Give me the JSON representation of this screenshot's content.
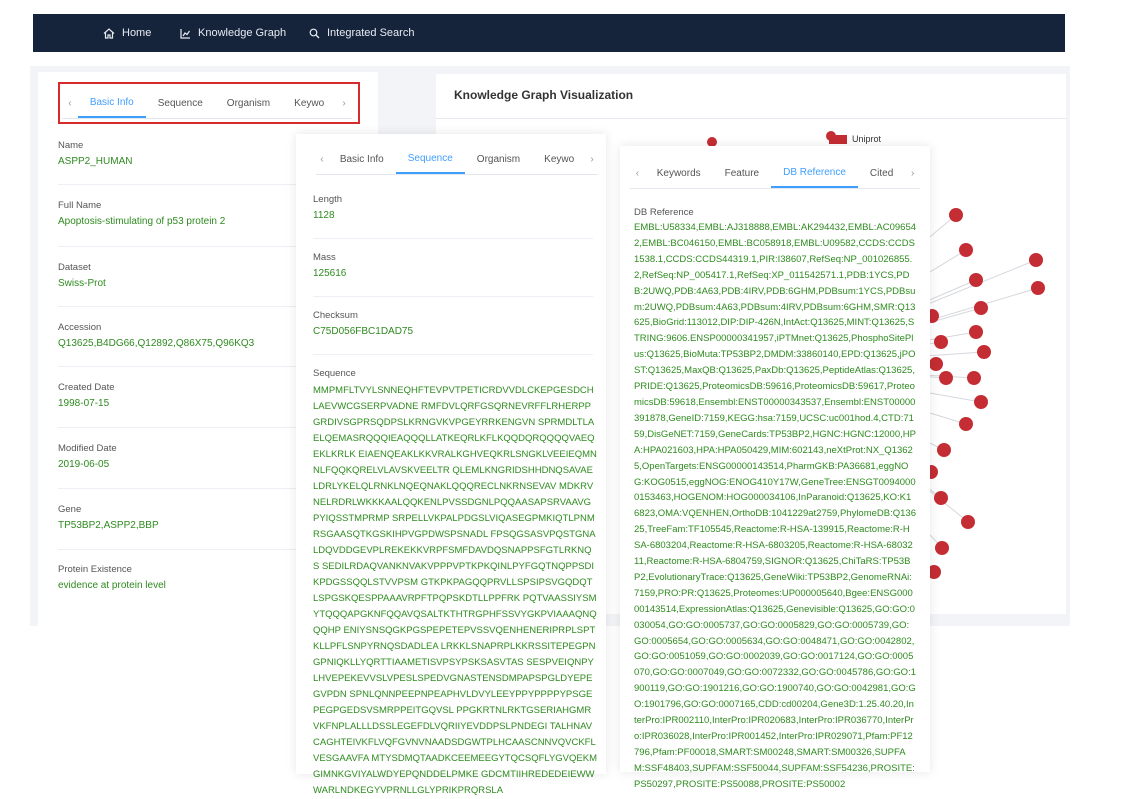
{
  "nav": {
    "items": [
      {
        "label": "Home",
        "icon": "home-icon"
      },
      {
        "label": "Knowledge Graph",
        "icon": "chart-icon"
      },
      {
        "label": "Integrated Search",
        "icon": "search-icon"
      }
    ]
  },
  "panel1": {
    "tabs": [
      "Basic Info",
      "Sequence",
      "Organism",
      "Keywo"
    ],
    "active_tab": "Basic Info",
    "fields": [
      {
        "label": "Name",
        "value": "ASPP2_HUMAN"
      },
      {
        "label": "Full Name",
        "value": "Apoptosis-stimulating of p53 protein 2"
      },
      {
        "label": "Dataset",
        "value": "Swiss-Prot"
      },
      {
        "label": "Accession",
        "value": "Q13625,B4DG66,Q12892,Q86X75,Q96KQ3"
      },
      {
        "label": "Created Date",
        "value": "1998-07-15"
      },
      {
        "label": "Modified Date",
        "value": "2019-06-05"
      },
      {
        "label": "Gene",
        "value": "TP53BP2,ASPP2,BBP"
      },
      {
        "label": "Protein Existence",
        "value": "evidence at protein level"
      }
    ]
  },
  "panel2": {
    "tabs": [
      "Basic Info",
      "Sequence",
      "Organism",
      "Keywo"
    ],
    "active_tab": "Sequence",
    "fields": [
      {
        "label": "Length",
        "value": "1128"
      },
      {
        "label": "Mass",
        "value": "125616"
      },
      {
        "label": "Checksum",
        "value": "C75D056FBC1DAD75"
      }
    ],
    "sequence_label": "Sequence",
    "sequence": "MMPMFLTVYLSNNEQHFTEVPVTPETICRDVVDLCKEPGESDCHLAEVWCGSERPVADNE RMFDVLQRFGSQRNEVRFFLRHERPPGRDIVSGPRSQDPSLKRNGVKVPGEYRRKENGVN SPRMDLTLAELQEMASRQQQIEAQQQLLATKEQRLKFLKQQDQRQQQQVAEQEKLKRLK EIAENQEAKLKKVRALKGHVEQKRLSNGKLVEEIEQMNNLFQQKQRELVLAVSKVEELTR QLEMLKNGRIDSHHDNQSAVAELDRLYKELQLRNKLNQEQNAKLQQQRECLNKRNSEVAV MDKRVNELRDRLWKKKAALQQKENLPVSSDGNLPQQAASAPSRVAAVGPYIQSSTMPRMP SRPELLVKPALPDGSLVIQASEGPMKIQTLPNMRSGAASQTKGSKIHPVGPDWSPSNADL FPSQGSASVPQSTGNALDQVDDGEVPLREKEKKVRPFSMFDAVDQSNAPPSFGTLRKNQS SEDILRDAQVANKNVAKVPPPVPTKPKQINLPYFGQTNQPPSDIKPDGSSQQLSTVVPSM GTKPKPAGQQPRVLLSPSIPSVGQDQTLSPGSKQESPPAAAVRPFTPQPSKDTLLPPFRK PQTVAASSIYSMYTQQQAPGKNFQQAVQSALTKTHTRGPHFSSVYGKPVIAAAQNQQQHP ENIYSNSQGKPGSPEPETEPVSSVQENHENERIPRPLSPTKLLPFLSNPYRNQSDADLEA LRKKLSNAPRPLKKRSSITEPEGPNGPNIQKLLYQRTTIAAMETISVPSYPSKSASVTAS SESPVEIQNPYLHVEPEKEVVSLVPESLSPEDVGNASTENSDMPAPSPGLDYEPEGVPDN SPNLQNNPEEPNPEAPHVLDVYLEEYPPYPPPPYPSGEPEGPGEDSVSMRPPEITGQVSL PPGKRTNLRKTGSERIAHGMRVKFNPLALLLDSSLEGEFDLVQRIIYEVDDPSLPNDEGI TALHNAVCAGHTEIVKFLVQFGVNVNAADSDGWTPLHCAASCNNVQVCKFLVESGAAVFA MTYSDMQTAADKCEEMEEGYTQCSQFLYGVQEKMGIMNKGVIYALWDYEPQNDDELPMKE GDCMTIIHREDEDEIEWWWARLNDKEGYVPRNLLGLYPRIKPRQRSLA"
  },
  "panel3": {
    "tabs": [
      "Keywords",
      "Feature",
      "DB Reference",
      "Cited"
    ],
    "active_tab": "DB Reference",
    "label": "DB Reference",
    "text": "EMBL:U58334,EMBL:AJ318888,EMBL:AK294432,EMBL:AC096542,EMBL:BC046150,EMBL:BC058918,EMBL:U09582,CCDS:CCDS1538.1,CCDS:CCDS44319.1,PIR:I38607,RefSeq:NP_001026855.2,RefSeq:NP_005417.1,RefSeq:XP_011542571.1,PDB:1YCS,PDB:2UWQ,PDB:4A63,PDB:4IRV,PDB:6GHM,PDBsum:1YCS,PDBsum:2UWQ,PDBsum:4A63,PDBsum:4IRV,PDBsum:6GHM,SMR:Q13625,BioGrid:113012,DIP:DIP-426N,IntAct:Q13625,MINT:Q13625,STRING:9606.ENSP00000341957,iPTMnet:Q13625,PhosphoSitePlus:Q13625,BioMuta:TP53BP2,DMDM:33860140,EPD:Q13625,jPOST:Q13625,MaxQB:Q13625,PaxDb:Q13625,PeptideAtlas:Q13625,PRIDE:Q13625,ProteomicsDB:59616,ProteomicsDB:59617,ProteomicsDB:59618,Ensembl:ENST00000343537,Ensembl:ENST00000391878,GeneID:7159,KEGG:hsa:7159,UCSC:uc001hod.4,CTD:7159,DisGeNET:7159,GeneCards:TP53BP2,HGNC:HGNC:12000,HPA:HPA021603,HPA:HPA050429,MIM:602143,neXtProt:NX_Q13625,OpenTargets:ENSG00000143514,PharmGKB:PA36681,eggNOG:KOG0515,eggNOG:ENOG410Y17W,GeneTree:ENSGT00940000153463,HOGENOM:HOG000034106,InParanoid:Q13625,KO:K16823,OMA:VQENHEN,OrthoDB:1041229at2759,PhylomeDB:Q13625,TreeFam:TF105545,Reactome:R-HSA-139915,Reactome:R-HSA-6803204,Reactome:R-HSA-6803205,Reactome:R-HSA-6803211,Reactome:R-HSA-6804759,SIGNOR:Q13625,ChiTaRS:TP53BP2,EvolutionaryTrace:Q13625,GeneWiki:TP53BP2,GenomeRNAi:7159,PRO:PR:Q13625,Proteomes:UP000005640,Bgee:ENSG00000143514,ExpressionAtlas:Q13625,Genevisible:Q13625,GO:GO:0030054,GO:GO:0005737,GO:GO:0005829,GO:GO:0005739,GO:GO:0005654,GO:GO:0005634,GO:GO:0048471,GO:GO:0042802,GO:GO:0051059,GO:GO:0002039,GO:GO:0017124,GO:GO:0005070,GO:GO:0007049,GO:GO:0072332,GO:GO:0045786,GO:GO:1900119,GO:GO:1901216,GO:GO:1900740,GO:GO:0042981,GO:GO:1901796,GO:GO:0007165,CDD:cd00204,Gene3D:1.25.40.20,InterPro:IPR002110,InterPro:IPR020683,InterPro:IPR036770,InterPro:IPR036028,InterPro:IPR001452,InterPro:IPR029071,Pfam:PF12796,Pfam:PF00018,SMART:SM00248,SMART:SM00326,SUPFAM:SSF48403,SUPFAM:SSF50044,SUPFAM:SSF54236,PROSITE:PS50297,PROSITE:PS50088,PROSITE:PS50002"
  },
  "knowledge_graph": {
    "title": "Knowledge Graph Visualization",
    "legend_label": "Uniprot",
    "node_color": "#c42d33",
    "edge_color": "#d4d7dc"
  },
  "colors": {
    "nav_bg": "#16243b",
    "accent": "#409eff",
    "value_green": "#2e8b1f",
    "highlight_red": "#d72b2b"
  }
}
